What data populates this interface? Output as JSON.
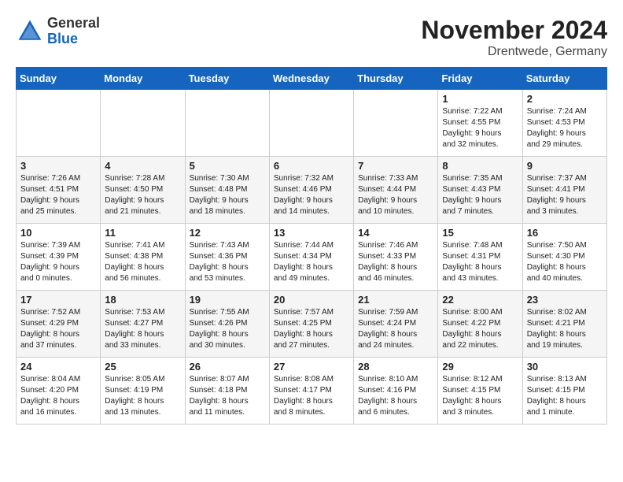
{
  "header": {
    "logo_general": "General",
    "logo_blue": "Blue",
    "month_title": "November 2024",
    "location": "Drentwede, Germany"
  },
  "weekdays": [
    "Sunday",
    "Monday",
    "Tuesday",
    "Wednesday",
    "Thursday",
    "Friday",
    "Saturday"
  ],
  "weeks": [
    [
      {
        "day": "",
        "info": ""
      },
      {
        "day": "",
        "info": ""
      },
      {
        "day": "",
        "info": ""
      },
      {
        "day": "",
        "info": ""
      },
      {
        "day": "",
        "info": ""
      },
      {
        "day": "1",
        "info": "Sunrise: 7:22 AM\nSunset: 4:55 PM\nDaylight: 9 hours\nand 32 minutes."
      },
      {
        "day": "2",
        "info": "Sunrise: 7:24 AM\nSunset: 4:53 PM\nDaylight: 9 hours\nand 29 minutes."
      }
    ],
    [
      {
        "day": "3",
        "info": "Sunrise: 7:26 AM\nSunset: 4:51 PM\nDaylight: 9 hours\nand 25 minutes."
      },
      {
        "day": "4",
        "info": "Sunrise: 7:28 AM\nSunset: 4:50 PM\nDaylight: 9 hours\nand 21 minutes."
      },
      {
        "day": "5",
        "info": "Sunrise: 7:30 AM\nSunset: 4:48 PM\nDaylight: 9 hours\nand 18 minutes."
      },
      {
        "day": "6",
        "info": "Sunrise: 7:32 AM\nSunset: 4:46 PM\nDaylight: 9 hours\nand 14 minutes."
      },
      {
        "day": "7",
        "info": "Sunrise: 7:33 AM\nSunset: 4:44 PM\nDaylight: 9 hours\nand 10 minutes."
      },
      {
        "day": "8",
        "info": "Sunrise: 7:35 AM\nSunset: 4:43 PM\nDaylight: 9 hours\nand 7 minutes."
      },
      {
        "day": "9",
        "info": "Sunrise: 7:37 AM\nSunset: 4:41 PM\nDaylight: 9 hours\nand 3 minutes."
      }
    ],
    [
      {
        "day": "10",
        "info": "Sunrise: 7:39 AM\nSunset: 4:39 PM\nDaylight: 9 hours\nand 0 minutes."
      },
      {
        "day": "11",
        "info": "Sunrise: 7:41 AM\nSunset: 4:38 PM\nDaylight: 8 hours\nand 56 minutes."
      },
      {
        "day": "12",
        "info": "Sunrise: 7:43 AM\nSunset: 4:36 PM\nDaylight: 8 hours\nand 53 minutes."
      },
      {
        "day": "13",
        "info": "Sunrise: 7:44 AM\nSunset: 4:34 PM\nDaylight: 8 hours\nand 49 minutes."
      },
      {
        "day": "14",
        "info": "Sunrise: 7:46 AM\nSunset: 4:33 PM\nDaylight: 8 hours\nand 46 minutes."
      },
      {
        "day": "15",
        "info": "Sunrise: 7:48 AM\nSunset: 4:31 PM\nDaylight: 8 hours\nand 43 minutes."
      },
      {
        "day": "16",
        "info": "Sunrise: 7:50 AM\nSunset: 4:30 PM\nDaylight: 8 hours\nand 40 minutes."
      }
    ],
    [
      {
        "day": "17",
        "info": "Sunrise: 7:52 AM\nSunset: 4:29 PM\nDaylight: 8 hours\nand 37 minutes."
      },
      {
        "day": "18",
        "info": "Sunrise: 7:53 AM\nSunset: 4:27 PM\nDaylight: 8 hours\nand 33 minutes."
      },
      {
        "day": "19",
        "info": "Sunrise: 7:55 AM\nSunset: 4:26 PM\nDaylight: 8 hours\nand 30 minutes."
      },
      {
        "day": "20",
        "info": "Sunrise: 7:57 AM\nSunset: 4:25 PM\nDaylight: 8 hours\nand 27 minutes."
      },
      {
        "day": "21",
        "info": "Sunrise: 7:59 AM\nSunset: 4:24 PM\nDaylight: 8 hours\nand 24 minutes."
      },
      {
        "day": "22",
        "info": "Sunrise: 8:00 AM\nSunset: 4:22 PM\nDaylight: 8 hours\nand 22 minutes."
      },
      {
        "day": "23",
        "info": "Sunrise: 8:02 AM\nSunset: 4:21 PM\nDaylight: 8 hours\nand 19 minutes."
      }
    ],
    [
      {
        "day": "24",
        "info": "Sunrise: 8:04 AM\nSunset: 4:20 PM\nDaylight: 8 hours\nand 16 minutes."
      },
      {
        "day": "25",
        "info": "Sunrise: 8:05 AM\nSunset: 4:19 PM\nDaylight: 8 hours\nand 13 minutes."
      },
      {
        "day": "26",
        "info": "Sunrise: 8:07 AM\nSunset: 4:18 PM\nDaylight: 8 hours\nand 11 minutes."
      },
      {
        "day": "27",
        "info": "Sunrise: 8:08 AM\nSunset: 4:17 PM\nDaylight: 8 hours\nand 8 minutes."
      },
      {
        "day": "28",
        "info": "Sunrise: 8:10 AM\nSunset: 4:16 PM\nDaylight: 8 hours\nand 6 minutes."
      },
      {
        "day": "29",
        "info": "Sunrise: 8:12 AM\nSunset: 4:15 PM\nDaylight: 8 hours\nand 3 minutes."
      },
      {
        "day": "30",
        "info": "Sunrise: 8:13 AM\nSunset: 4:15 PM\nDaylight: 8 hours\nand 1 minute."
      }
    ]
  ]
}
